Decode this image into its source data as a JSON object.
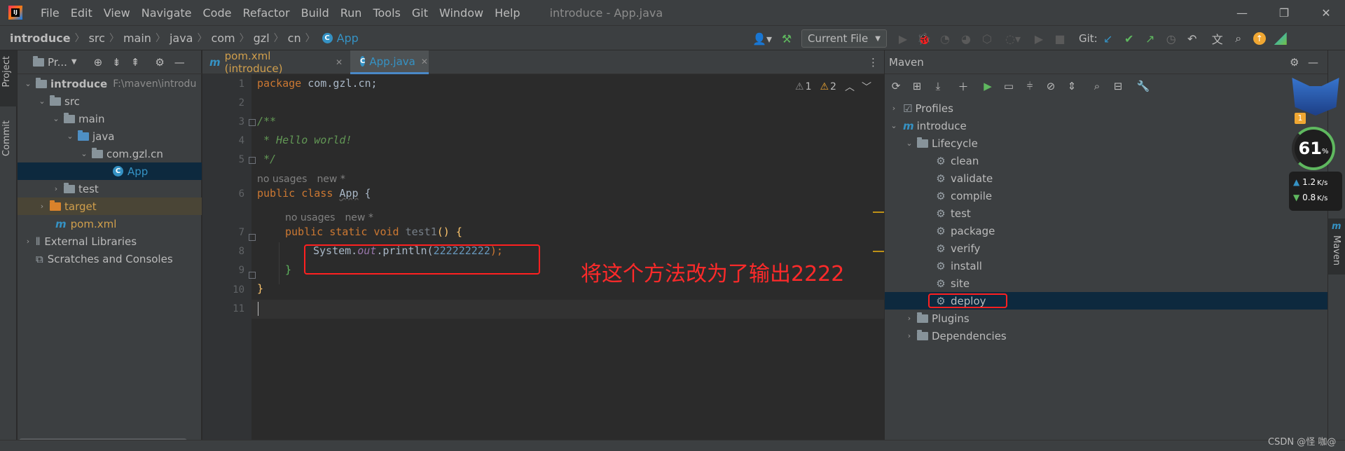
{
  "menubar": {
    "items": [
      "File",
      "Edit",
      "View",
      "Navigate",
      "Code",
      "Refactor",
      "Build",
      "Run",
      "Tools",
      "Git",
      "Window",
      "Help"
    ],
    "window_title": "introduce - App.java"
  },
  "navbar": {
    "breadcrumbs": [
      "introduce",
      "src",
      "main",
      "java",
      "com",
      "gzl",
      "cn",
      "App"
    ],
    "run_config": "Current File",
    "git_label": "Git:"
  },
  "left_strip": {
    "project_tab": "Project",
    "commit_tab": "Commit"
  },
  "project": {
    "title": "Pr...",
    "root_name": "introduce",
    "root_path": "F:\\maven\\introdu",
    "nodes": [
      "src",
      "main",
      "java",
      "com.gzl.cn",
      "App",
      "test",
      "target",
      "pom.xml",
      "External Libraries",
      "Scratches and Consoles"
    ]
  },
  "editor": {
    "tabs": [
      {
        "label": "pom.xml (introduce)"
      },
      {
        "label": "App.java"
      }
    ],
    "warnings": {
      "w1": "1",
      "w2": "2"
    },
    "line_numbers": [
      "1",
      "2",
      "3",
      "4",
      "5",
      "6",
      "7",
      "8",
      "9",
      "10",
      "11"
    ],
    "usage_hint_1": "no usages",
    "new_hint_1": "new *",
    "usage_hint_2": "no usages",
    "new_hint_2": "new *",
    "code": {
      "l1_kw": "package",
      "l1_rest": " com.gzl.cn;",
      "l3": "/**",
      "l4": " * Hello world!",
      "l5": " */",
      "l6_kw": "public class",
      "l6_name": "App",
      "l6_brace": " {",
      "l7_kw": "public static void",
      "l7_name": "test1",
      "l7_rest": "() {",
      "l8_a": "System.",
      "l8_out": "out",
      "l8_b": ".println(",
      "l8_num": "222222222",
      "l8_c": ");",
      "l9": "}",
      "l10": "}"
    }
  },
  "annotation": "将这个方法改为了输出2222",
  "maven": {
    "title": "Maven",
    "profiles": "Profiles",
    "project": "introduce",
    "lifecycle": "Lifecycle",
    "phases": [
      "clean",
      "validate",
      "compile",
      "test",
      "package",
      "verify",
      "install",
      "site",
      "deploy"
    ],
    "plugins": "Plugins",
    "dependencies": "Dependencies",
    "side_label": "Maven"
  },
  "widget": {
    "percent": "61",
    "percent_sign": "%",
    "up": "1.2",
    "down": "0.8",
    "unit": "K/s",
    "badge": "1"
  },
  "watermark": "CSDN @怪 咖@",
  "colors": {
    "accent": "#3592c4",
    "selection": "#0d293e",
    "annotation": "#ff2a2a"
  }
}
